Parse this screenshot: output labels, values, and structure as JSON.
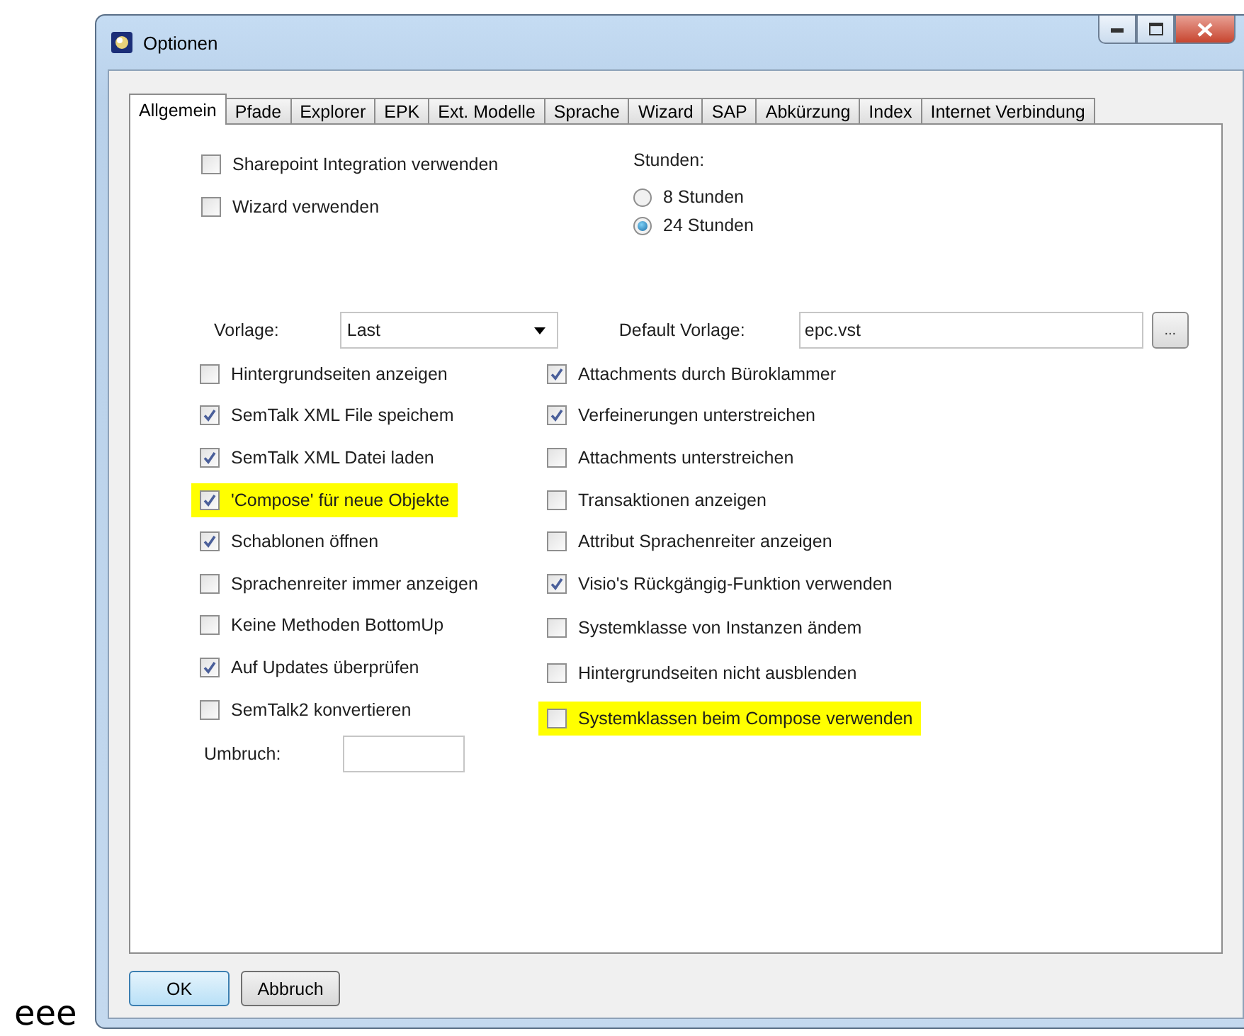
{
  "side_text": "eee",
  "window": {
    "title": "Optionen"
  },
  "tabs": [
    {
      "label": "Allgemein",
      "selected": true
    },
    {
      "label": "Pfade",
      "selected": false
    },
    {
      "label": "Explorer",
      "selected": false
    },
    {
      "label": "EPK",
      "selected": false
    },
    {
      "label": "Ext. Modelle",
      "selected": false
    },
    {
      "label": "Sprache",
      "selected": false
    },
    {
      "label": "Wizard",
      "selected": false
    },
    {
      "label": "SAP",
      "selected": false
    },
    {
      "label": "Abkürzung",
      "selected": false
    },
    {
      "label": "Index",
      "selected": false
    },
    {
      "label": "Internet Verbindung",
      "selected": false
    }
  ],
  "top_options": [
    {
      "label": "Sharepoint Integration verwenden",
      "checked": false
    },
    {
      "label": "Wizard verwenden",
      "checked": false
    }
  ],
  "hours": {
    "label": "Stunden:",
    "options": [
      {
        "label": "8 Stunden",
        "selected": false
      },
      {
        "label": "24 Stunden",
        "selected": true
      }
    ]
  },
  "template": {
    "label": "Vorlage:",
    "value": "Last"
  },
  "default_template": {
    "label": "Default Vorlage:",
    "value": "epc.vst",
    "button": "..."
  },
  "left_options": [
    {
      "label": "Hintergrundseiten anzeigen",
      "checked": false,
      "highlighted": false
    },
    {
      "label": "SemTalk XML File speichem",
      "checked": true,
      "highlighted": false
    },
    {
      "label": "SemTalk XML Datei laden",
      "checked": true,
      "highlighted": false
    },
    {
      "label": "'Compose' für neue Objekte",
      "checked": true,
      "highlighted": true
    },
    {
      "label": "Schablonen öffnen",
      "checked": true,
      "highlighted": false
    },
    {
      "label": "Sprachenreiter immer anzeigen",
      "checked": false,
      "highlighted": false
    },
    {
      "label": "Keine Methoden BottomUp",
      "checked": false,
      "highlighted": false
    },
    {
      "label": "Auf Updates überprüfen",
      "checked": true,
      "highlighted": false
    },
    {
      "label": "SemTalk2 konvertieren",
      "checked": false,
      "highlighted": false
    }
  ],
  "right_options": [
    {
      "label": "Attachments  durch Büroklammer",
      "checked": true,
      "highlighted": false
    },
    {
      "label": "Verfeinerungen unterstreichen",
      "checked": true,
      "highlighted": false
    },
    {
      "label": "Attachments unterstreichen",
      "checked": false,
      "highlighted": false
    },
    {
      "label": "Transaktionen anzeigen",
      "checked": false,
      "highlighted": false
    },
    {
      "label": "Attribut Sprachenreiter anzeigen",
      "checked": false,
      "highlighted": false
    },
    {
      "label": "Visio's Rückgängig-Funktion verwenden",
      "checked": true,
      "highlighted": false
    },
    {
      "label": "Systemklasse von Instanzen ändem",
      "checked": false,
      "highlighted": false
    },
    {
      "label": "Hintergrundseiten nicht ausblenden",
      "checked": false,
      "highlighted": false
    },
    {
      "label": "Systemklassen beim Compose verwenden",
      "checked": false,
      "highlighted": true
    }
  ],
  "wrap": {
    "label": "Umbruch:"
  },
  "buttons": [
    {
      "label": "OK",
      "kind": "default"
    },
    {
      "label": "Abbruch",
      "kind": "normal"
    }
  ]
}
